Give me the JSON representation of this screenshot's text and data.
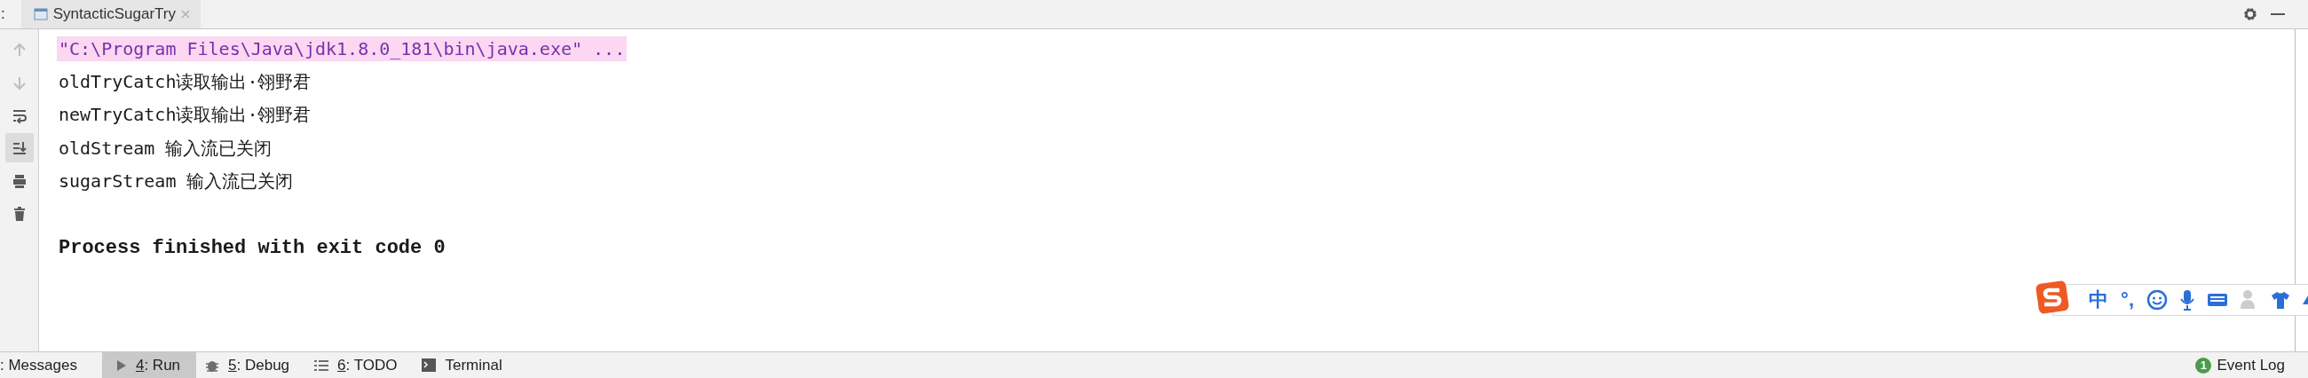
{
  "tool_window": {
    "left_edge_mark": ":",
    "tab": {
      "title": "SyntacticSugarTry",
      "selected": true
    }
  },
  "toolbar": [
    {
      "kind": "up",
      "disabled": true,
      "selected": false
    },
    {
      "kind": "down",
      "disabled": true,
      "selected": false
    },
    {
      "kind": "wrap",
      "disabled": false,
      "selected": false
    },
    {
      "kind": "scroll-end",
      "disabled": false,
      "selected": true
    },
    {
      "kind": "print",
      "disabled": false,
      "selected": false
    },
    {
      "kind": "trash",
      "disabled": false,
      "selected": false
    }
  ],
  "console": [
    {
      "kind": "command",
      "text": "\"C:\\Program Files\\Java\\jdk1.8.0_181\\bin\\java.exe\" ..."
    },
    {
      "kind": "output",
      "text": "oldTryCatch读取输出·翎野君"
    },
    {
      "kind": "output",
      "text": "newTryCatch读取输出·翎野君"
    },
    {
      "kind": "output",
      "text": "oldStream 输入流已关闭"
    },
    {
      "kind": "output",
      "text": "sugarStream 输入流已关闭"
    },
    {
      "kind": "blank"
    },
    {
      "kind": "exit",
      "text": "Process finished with exit code 0"
    }
  ],
  "ime_toolbar": {
    "mode": "中",
    "punctuation": "°,"
  },
  "status_bar": {
    "tabs": [
      {
        "kind": "none",
        "label": ": Messages",
        "selected": false
      },
      {
        "kind": "run",
        "label": "4: Run",
        "selected": true
      },
      {
        "kind": "debug",
        "label": "5: Debug",
        "selected": false
      },
      {
        "kind": "todo",
        "label": "6: TODO",
        "selected": false
      },
      {
        "kind": "terminal",
        "label": "Terminal",
        "selected": false
      }
    ],
    "event_log": {
      "count": "1",
      "label": "Event Log"
    }
  }
}
